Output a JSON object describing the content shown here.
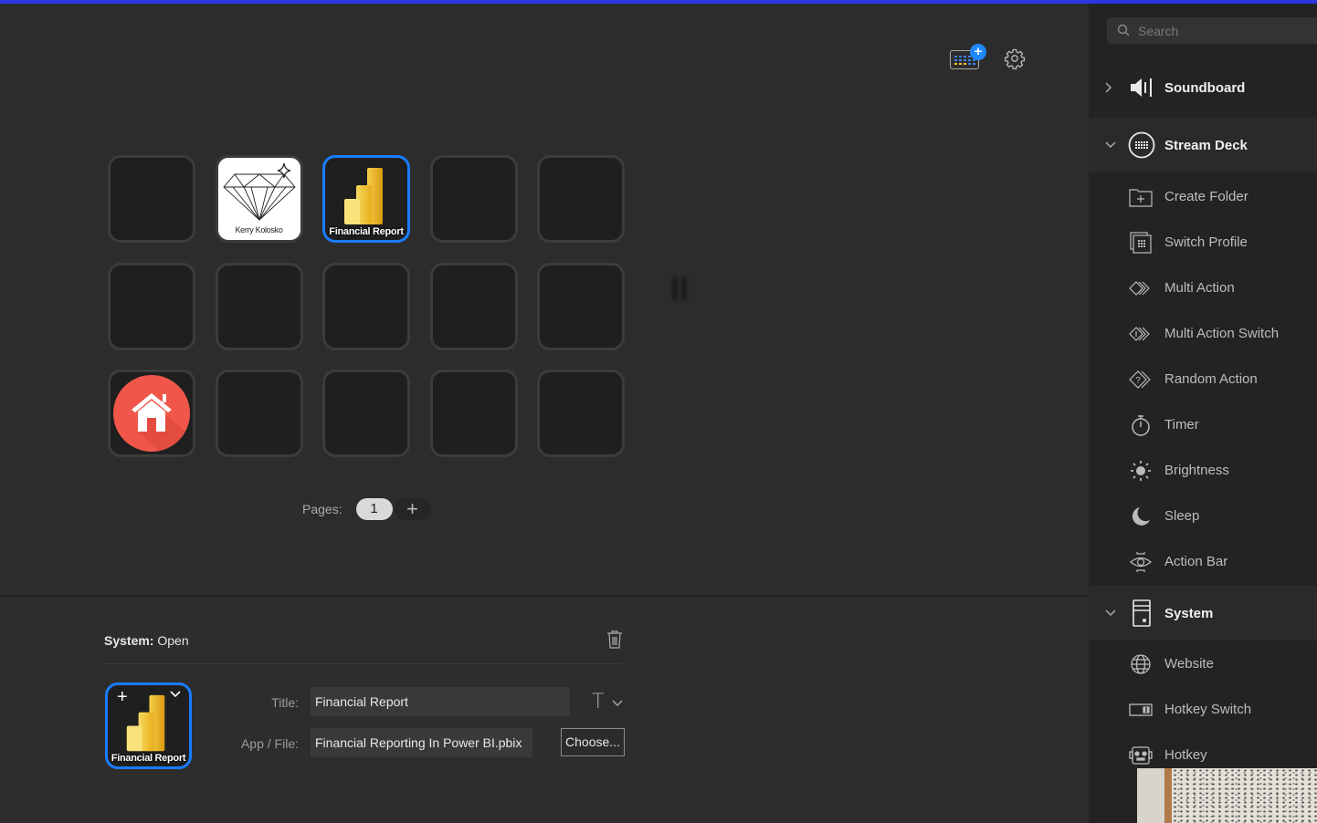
{
  "colors": {
    "accent": "#1a7cff",
    "top_bar": "#2a36e0",
    "home_red": "#f0574a",
    "powerbi_yellow": "#f2c12e"
  },
  "header": {
    "add_device_icon": "keyboard-plus-icon",
    "settings_icon": "gear-icon"
  },
  "keys": [
    {
      "label": "",
      "type": "empty"
    },
    {
      "label": "Kerry Kolosko",
      "type": "diamond-logo"
    },
    {
      "label": "Financial Report",
      "type": "powerbi",
      "selected": true
    },
    {
      "label": "",
      "type": "empty"
    },
    {
      "label": "",
      "type": "empty"
    },
    {
      "label": "",
      "type": "empty"
    },
    {
      "label": "",
      "type": "empty"
    },
    {
      "label": "",
      "type": "empty"
    },
    {
      "label": "",
      "type": "empty"
    },
    {
      "label": "",
      "type": "empty"
    },
    {
      "label": "",
      "type": "home"
    },
    {
      "label": "",
      "type": "empty"
    },
    {
      "label": "",
      "type": "empty"
    },
    {
      "label": "",
      "type": "empty"
    },
    {
      "label": "",
      "type": "empty"
    }
  ],
  "pages": {
    "label": "Pages:",
    "current": "1",
    "add": "+"
  },
  "inspector": {
    "category": "System:",
    "action": "Open",
    "key_label": "Financial Report",
    "title_label": "Title:",
    "title_value": "Financial Report",
    "file_label": "App / File:",
    "file_value": "Financial Reporting In Power BI.pbix",
    "choose_label": "Choose..."
  },
  "sidebar": {
    "search_placeholder": "Search",
    "categories": [
      {
        "label": "Soundboard",
        "icon": "speaker-icon",
        "expanded": false
      },
      {
        "label": "Stream Deck",
        "icon": "stream-deck-icon",
        "expanded": true,
        "items": [
          {
            "label": "Create Folder",
            "icon": "folder-plus-icon"
          },
          {
            "label": "Switch Profile",
            "icon": "switch-profile-icon"
          },
          {
            "label": "Multi Action",
            "icon": "multi-action-icon"
          },
          {
            "label": "Multi Action Switch",
            "icon": "multi-action-switch-icon"
          },
          {
            "label": "Random Action",
            "icon": "random-action-icon"
          },
          {
            "label": "Timer",
            "icon": "timer-icon"
          },
          {
            "label": "Brightness",
            "icon": "brightness-icon"
          },
          {
            "label": "Sleep",
            "icon": "moon-icon"
          },
          {
            "label": "Action Bar",
            "icon": "eye-icon"
          }
        ]
      },
      {
        "label": "System",
        "icon": "computer-tower-icon",
        "expanded": true,
        "items": [
          {
            "label": "Website",
            "icon": "globe-icon"
          },
          {
            "label": "Hotkey Switch",
            "icon": "toggle-icon"
          },
          {
            "label": "Hotkey",
            "icon": "robot-icon"
          }
        ]
      }
    ]
  }
}
